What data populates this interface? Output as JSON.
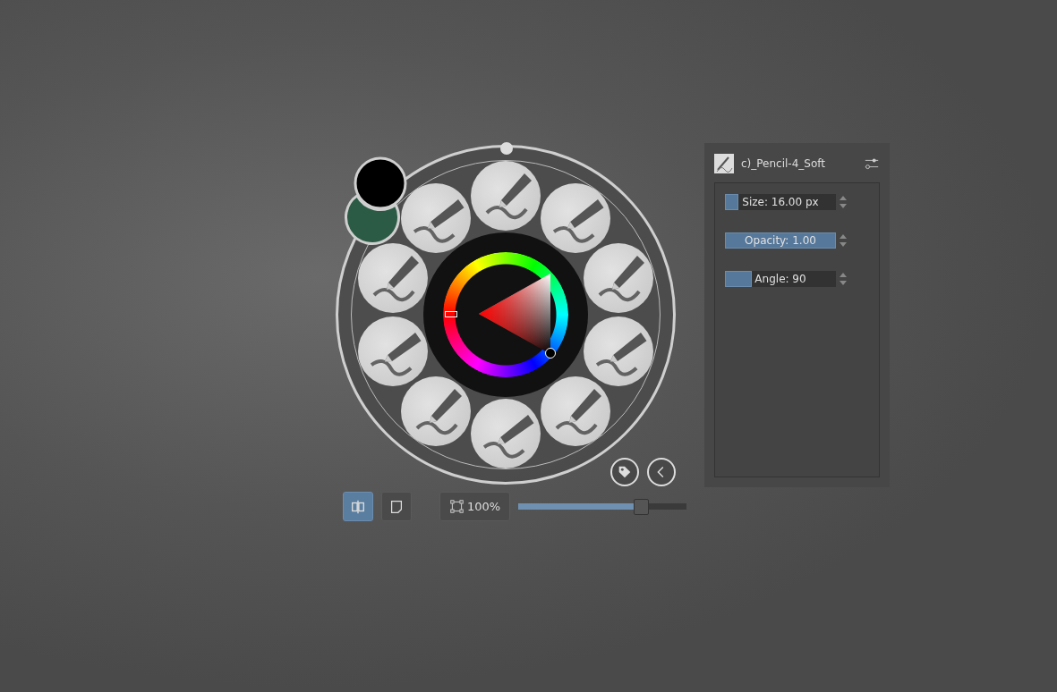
{
  "color_swatches": [
    {
      "color": "#000000"
    },
    {
      "color": "#2c5b45"
    }
  ],
  "brush_panel": {
    "preset_name": "c)_Pencil-4_Soft",
    "sliders": [
      {
        "label": "Size: 16.00 px",
        "level": 0.12
      },
      {
        "label": "Opacity: 1.00",
        "level": 1.0
      },
      {
        "label": "Angle: 90",
        "level": 0.24
      }
    ]
  },
  "bottom_bar": {
    "mirror_selected": true,
    "zoom_label": "100%",
    "zoom_slider": {
      "level": 0.73
    }
  }
}
